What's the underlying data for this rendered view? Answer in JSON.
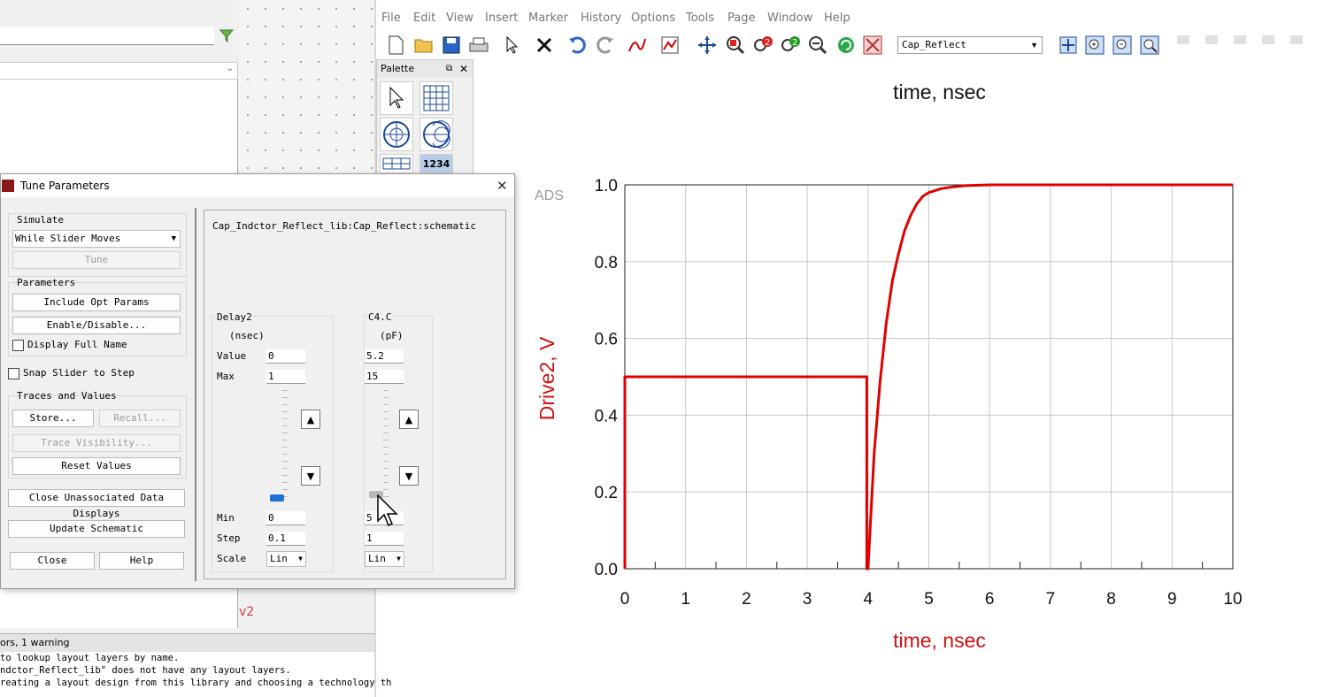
{
  "menu": [
    "File",
    "Edit",
    "View",
    "Insert",
    "Marker",
    "History",
    "Options",
    "Tools",
    "Page",
    "Window",
    "Help"
  ],
  "toolbar": {
    "page_select_value": "Cap_Reflect",
    "icons": [
      "new-page-icon",
      "open-icon",
      "save-icon",
      "print-icon",
      "select-pointer-icon",
      "delete-icon",
      "undo-icon",
      "redo-icon",
      "insert-trace-icon",
      "plot-icon",
      "move-icon",
      "zoom-area-icon",
      "zoom-in-icon",
      "zoom-out-icon",
      "zoom-icon",
      "refresh-icon",
      "stop-icon",
      "view-all-icon",
      "zoom-plus-icon",
      "zoom-minus-icon",
      "zoom-fit-icon"
    ]
  },
  "palette": {
    "title": "Palette",
    "items": [
      "pointer-icon",
      "rectangular-plot-icon",
      "polar-plot-icon",
      "smith-chart-icon",
      "stack-plot-icon",
      "list-icon"
    ],
    "list_label": "1234"
  },
  "ads_watermark": "ADS",
  "dialog": {
    "title": "Tune Parameters",
    "simulate_group": "Simulate",
    "simulate_mode": "While Slider Moves",
    "tune_label": "Tune",
    "parameters_group": "Parameters",
    "include_opt_params": "Include Opt Params",
    "enable_disable": "Enable/Disable...",
    "display_full_name": "Display Full Name",
    "snap_slider": "Snap Slider to Step",
    "traces_group": "Traces and Values",
    "store": "Store...",
    "recall": "Recall...",
    "trace_visibility": "Trace Visibility...",
    "reset_values": "Reset Values",
    "close_unassociated": "Close Unassociated Data Displays",
    "update_schematic": "Update Schematic",
    "close": "Close",
    "help": "Help",
    "schematic_path": "Cap_Indctor_Reflect_lib:Cap_Reflect:schematic",
    "params": [
      {
        "name": "Delay2",
        "unit": "(nsec)",
        "value": "0",
        "max": "1",
        "min": "0",
        "step": "0.1",
        "scale": "Lin",
        "level": 0
      },
      {
        "name": "C4.C",
        "unit": "(pF)",
        "value": "5.2",
        "max": "15",
        "min": "5",
        "step": "1",
        "scale": "Lin",
        "level": 0.02
      }
    ],
    "row_labels": {
      "value": "Value",
      "max": "Max",
      "min": "Min",
      "step": "Step",
      "scale": "Scale"
    }
  },
  "left_panel": {
    "message_header": "ors, 1 warning",
    "messages": [
      " to lookup layout layers by name.",
      "ndctor_Reflect_lib\" does not have any layout layers.",
      "reating a layout design from this library and choosing a technology th"
    ]
  },
  "chart_data": {
    "type": "line",
    "title": "time, nsec",
    "xlabel": "time, nsec",
    "ylabel": "Drive2, V",
    "xlim": [
      0,
      10
    ],
    "ylim": [
      0,
      1
    ],
    "xticks": [
      "0",
      "1",
      "2",
      "3",
      "4",
      "5",
      "6",
      "7",
      "8",
      "9",
      "10"
    ],
    "yticks": [
      "0.0",
      "0.2",
      "0.4",
      "0.6",
      "0.8",
      "1.0"
    ],
    "grid": true,
    "series": [
      {
        "color": "#e00000",
        "x": [
          0,
          0,
          0.5,
          1,
          2,
          3,
          3.98,
          3.98,
          4.0,
          4.1,
          4.2,
          4.3,
          4.4,
          4.5,
          4.6,
          4.7,
          4.8,
          4.9,
          5.0,
          5.2,
          5.4,
          5.6,
          6,
          7,
          8,
          9,
          10
        ],
        "y": [
          0,
          0.5,
          0.5,
          0.5,
          0.5,
          0.5,
          0.5,
          0,
          0,
          0.3,
          0.49,
          0.64,
          0.75,
          0.82,
          0.88,
          0.92,
          0.95,
          0.97,
          0.98,
          0.99,
          0.995,
          0.998,
          1,
          1,
          1,
          1,
          1
        ]
      }
    ]
  }
}
